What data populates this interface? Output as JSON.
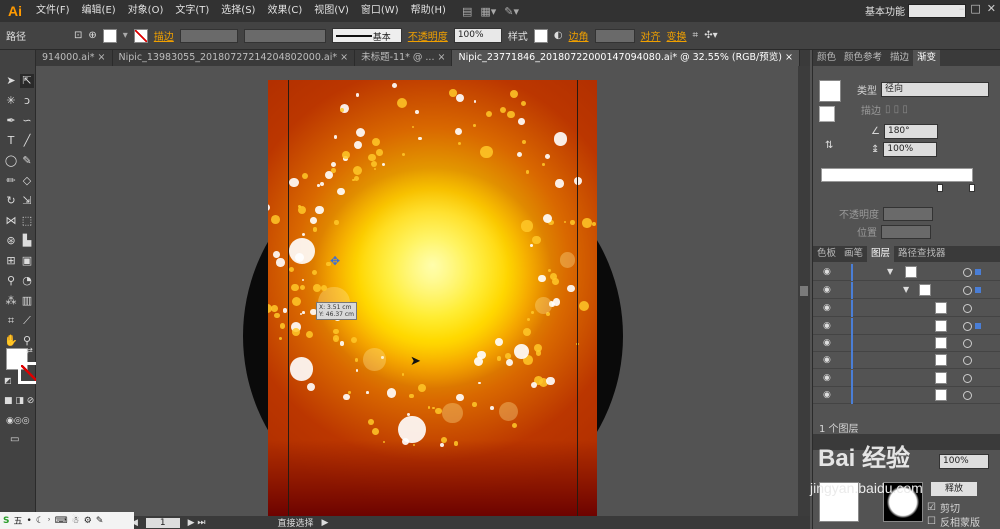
{
  "app": {
    "logo": "Ai",
    "menus": [
      "文件(F)",
      "编辑(E)",
      "对象(O)",
      "文字(T)",
      "选择(S)",
      "效果(C)",
      "视图(V)",
      "窗口(W)",
      "帮助(H)"
    ],
    "workspace": "基本功能",
    "accent_color": "#ff9a00"
  },
  "control_bar": {
    "object_label": "路径",
    "stroke_label": "描边",
    "stroke_style": "基本",
    "opacity_label": "不透明度",
    "opacity_value": "100%",
    "style_label": "样式",
    "corner_label": "边角",
    "align_label": "对齐",
    "transform_label": "变换"
  },
  "tabs": [
    {
      "label": "914000.ai*",
      "close": "×",
      "active": false
    },
    {
      "label": "Nipic_13983055_20180727214204802000.ai*",
      "close": "×",
      "active": false
    },
    {
      "label": "未标题-11* @ ...",
      "close": "×",
      "active": false
    },
    {
      "label": "Nipic_23771846_20180722000147094080.ai* @ 32.55% (RGB/预览)",
      "close": "×",
      "active": true
    }
  ],
  "canvas": {
    "readout_x": "X: 3.51 cm",
    "readout_y": "Y: 46.37 cm"
  },
  "status": {
    "zoom": "1",
    "tool_name": "直接选择"
  },
  "gradient_panel": {
    "tabs": [
      "颜色",
      "颜色参考",
      "描边",
      "渐变"
    ],
    "type_label": "类型",
    "type_value": "径向",
    "stroke_label": "描边",
    "angle_value": "180°",
    "aspect_value": "100%",
    "opacity_label": "不透明度",
    "location_label": "位置"
  },
  "layers_panel": {
    "tabs": [
      "色板",
      "画笔",
      "图层",
      "路径查找器"
    ],
    "footer": "1 个图层"
  },
  "transparency_panel": {
    "opacity_value": "100%",
    "make_mask_label": "释放",
    "clip_label": "剪切",
    "invert_label": "反相蒙版"
  },
  "watermark": {
    "text": "Bai 经验",
    "url": "jingyan.baidu.com"
  },
  "taskbar": {
    "ime": "五"
  }
}
